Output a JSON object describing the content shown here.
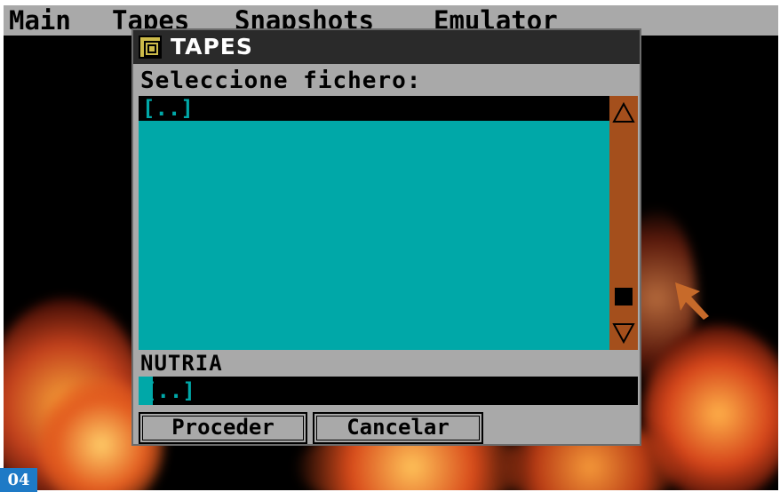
{
  "menubar": {
    "items": [
      "Main",
      "Tapes",
      "Snapshots",
      "Emulator"
    ]
  },
  "dialog": {
    "title": "TAPES",
    "prompt": "Seleccione fichero:",
    "list": {
      "items": [
        "[..]"
      ]
    },
    "filename_label": "NUTRIA",
    "path_input": {
      "value": "[..]"
    },
    "buttons": {
      "proceed": "Proceder",
      "cancel": "Cancelar"
    }
  },
  "badge": {
    "label": "04"
  },
  "icons": {
    "title": "tape-window-icon",
    "scroll_up": "triangle-up-icon",
    "scroll_down": "triangle-down-icon",
    "pointer": "mouse-pointer-icon"
  },
  "colors": {
    "menubar_bg": "#a9a9a9",
    "list_bg": "#00a8a8",
    "scrollbar": "#a44f1c",
    "selection_fg": "#00a8a8",
    "title_bg": "#2a2a2a",
    "badge_bg": "#1e7ac6"
  }
}
